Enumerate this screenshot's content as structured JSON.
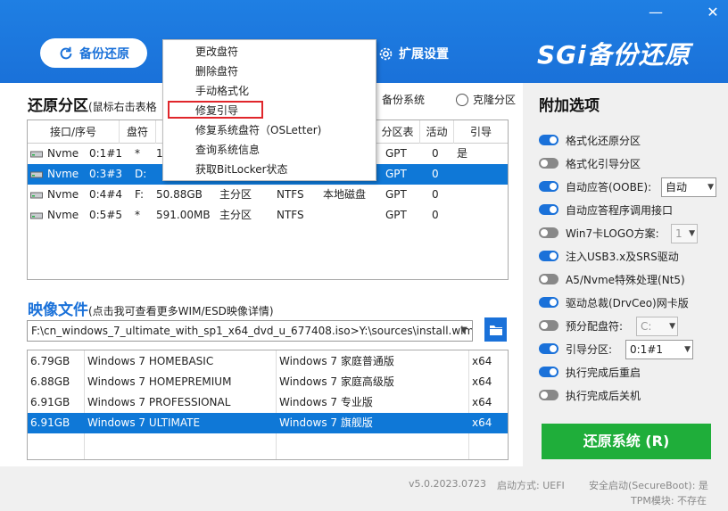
{
  "window": {
    "minimize_symbol": "—",
    "close_symbol": "✕"
  },
  "header": {
    "tab_backup_label": "备份还原",
    "tab_ext_label": "扩展设置",
    "logo_text": "SGi备份还原"
  },
  "partition": {
    "title": "还原分区",
    "hint": "(鼠标右击表格",
    "radio_backup": "备份系统",
    "radio_clone": "克隆分区",
    "columns": [
      "接口/序号",
      "盘符",
      "分区表",
      "活动",
      "引导"
    ],
    "rows": [
      {
        "iface": "Nvme",
        "num": "0:1#1",
        "letter": "*",
        "size": "1",
        "type": "",
        "fs": "",
        "desc": "",
        "table": "GPT",
        "active": "0",
        "boot": "是"
      },
      {
        "iface": "Nvme",
        "num": "0:3#3",
        "letter": "D:",
        "size": "",
        "type": "",
        "fs": "",
        "desc": "",
        "table": "GPT",
        "active": "0",
        "boot": ""
      },
      {
        "iface": "Nvme",
        "num": "0:4#4",
        "letter": "F:",
        "size": "50.88GB",
        "type": "主分区",
        "fs": "NTFS",
        "desc": "本地磁盘",
        "table": "GPT",
        "active": "0",
        "boot": ""
      },
      {
        "iface": "Nvme",
        "num": "0:5#5",
        "letter": "*",
        "size": "591.00MB",
        "type": "主分区",
        "fs": "NTFS",
        "desc": "",
        "table": "GPT",
        "active": "0",
        "boot": ""
      }
    ]
  },
  "context_menu": {
    "items": [
      "更改盘符",
      "删除盘符",
      "手动格式化",
      "修复引导",
      "修复系统盘符（OSLetter)",
      "查询系统信息",
      "获取BitLocker状态"
    ],
    "highlighted_index": 3
  },
  "image": {
    "title": "映像文件",
    "hint": "(点击我可查看更多WIM/ESD映像详情)",
    "path": "F:\\cn_windows_7_ultimate_with_sp1_x64_dvd_u_677408.iso>Y:\\sources\\install.wim",
    "rows": [
      {
        "size": "6.79GB",
        "name": "Windows 7 HOMEBASIC",
        "cn": "Windows 7 家庭普通版",
        "arch": "x64"
      },
      {
        "size": "6.88GB",
        "name": "Windows 7 HOMEPREMIUM",
        "cn": "Windows 7 家庭高级版",
        "arch": "x64"
      },
      {
        "size": "6.91GB",
        "name": "Windows 7 PROFESSIONAL",
        "cn": "Windows 7 专业版",
        "arch": "x64"
      },
      {
        "size": "6.91GB",
        "name": "Windows 7 ULTIMATE",
        "cn": "Windows 7 旗舰版",
        "arch": "x64"
      }
    ],
    "selected_index": 3
  },
  "options": {
    "title": "附加选项",
    "items": [
      {
        "label": "格式化还原分区",
        "on": true
      },
      {
        "label": "格式化引导分区",
        "on": false
      },
      {
        "label": "自动应答(OOBE):",
        "on": true
      },
      {
        "label": "自动应答程序调用接口",
        "on": true
      },
      {
        "label": "Win7卡LOGO方案:",
        "on": false
      },
      {
        "label": "注入USB3.x及SRS驱动",
        "on": true
      },
      {
        "label": "A5/Nvme特殊处理(Nt5)",
        "on": false
      },
      {
        "label": "驱动总裁(DrvCeo)网卡版",
        "on": true
      },
      {
        "label": "预分配盘符:",
        "on": false
      },
      {
        "label": "引导分区:",
        "on": true
      },
      {
        "label": "执行完成后重启",
        "on": true
      },
      {
        "label": "执行完成后关机",
        "on": false
      }
    ],
    "oobe_value": "自动",
    "logo_value": "1",
    "letter_value": "C:",
    "boot_value": "0:1#1",
    "restore_button": "还原系统 (R)"
  },
  "footer": {
    "version": "v5.0.2023.0723",
    "boot_mode": "启动方式:  UEFI",
    "secure_boot": "安全启动(SecureBoot):  是",
    "tpm": "TPM模块:  不存在"
  },
  "colors": {
    "accent": "#1a71d9",
    "selection": "#0f78d7",
    "button_green": "#1fae3a",
    "menu_highlight": "#e0262b"
  }
}
